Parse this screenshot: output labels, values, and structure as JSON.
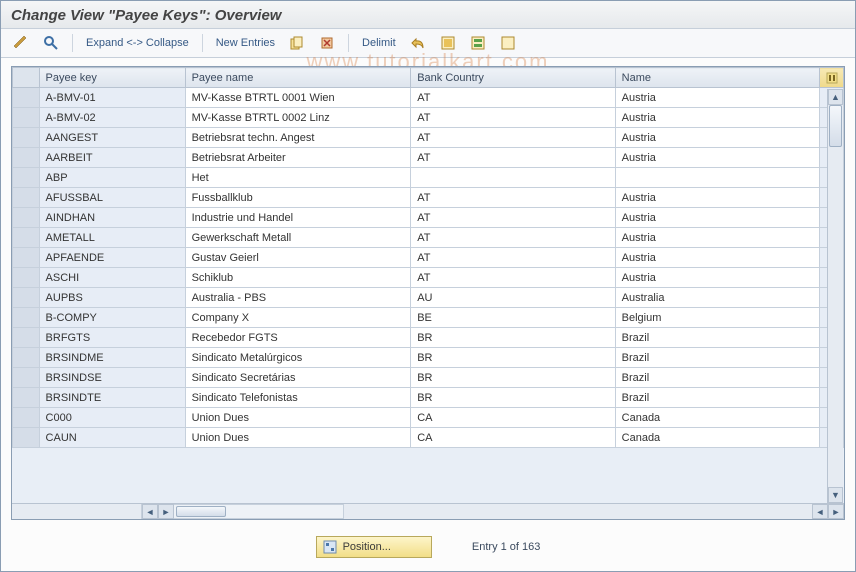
{
  "title": "Change View \"Payee Keys\": Overview",
  "toolbar": {
    "expand_collapse": "Expand <-> Collapse",
    "new_entries": "New Entries",
    "delimit": "Delimit"
  },
  "columns": {
    "payee_key": "Payee key",
    "payee_name": "Payee name",
    "bank_country": "Bank Country",
    "name": "Name"
  },
  "rows": [
    {
      "key": "A-BMV-01",
      "pname": "MV-Kasse  BTRTL 0001 Wien",
      "bc": "AT",
      "cn": "Austria"
    },
    {
      "key": "A-BMV-02",
      "pname": "MV-Kasse  BTRTL 0002 Linz",
      "bc": "AT",
      "cn": "Austria"
    },
    {
      "key": "AANGEST",
      "pname": "Betriebsrat techn. Angest",
      "bc": "AT",
      "cn": "Austria"
    },
    {
      "key": "AARBEIT",
      "pname": "Betriebsrat Arbeiter",
      "bc": "AT",
      "cn": "Austria"
    },
    {
      "key": "ABP",
      "pname": "Het",
      "bc": "",
      "cn": ""
    },
    {
      "key": "AFUSSBAL",
      "pname": "Fussballklub",
      "bc": "AT",
      "cn": "Austria"
    },
    {
      "key": "AINDHAN",
      "pname": "Industrie und Handel",
      "bc": "AT",
      "cn": "Austria"
    },
    {
      "key": "AMETALL",
      "pname": "Gewerkschaft Metall",
      "bc": "AT",
      "cn": "Austria"
    },
    {
      "key": "APFAENDE",
      "pname": "Gustav Geierl",
      "bc": "AT",
      "cn": "Austria"
    },
    {
      "key": "ASCHI",
      "pname": "Schiklub",
      "bc": "AT",
      "cn": "Austria"
    },
    {
      "key": "AUPBS",
      "pname": "Australia - PBS",
      "bc": "AU",
      "cn": "Australia"
    },
    {
      "key": "B-COMPY",
      "pname": "Company X",
      "bc": "BE",
      "cn": "Belgium"
    },
    {
      "key": "BRFGTS",
      "pname": "Recebedor FGTS",
      "bc": "BR",
      "cn": "Brazil"
    },
    {
      "key": "BRSINDME",
      "pname": "Sindicato Metalúrgicos",
      "bc": "BR",
      "cn": "Brazil"
    },
    {
      "key": "BRSINDSE",
      "pname": "Sindicato Secretárias",
      "bc": "BR",
      "cn": "Brazil"
    },
    {
      "key": "BRSINDTE",
      "pname": "Sindicato Telefonistas",
      "bc": "BR",
      "cn": "Brazil"
    },
    {
      "key": "C000",
      "pname": "Union Dues",
      "bc": "CA",
      "cn": "Canada"
    },
    {
      "key": "CAUN",
      "pname": "Union Dues",
      "bc": "CA",
      "cn": "Canada"
    }
  ],
  "footer": {
    "position_label": "Position...",
    "entry_label": "Entry 1 of 163"
  },
  "watermark": "www.tutorialkart.com"
}
